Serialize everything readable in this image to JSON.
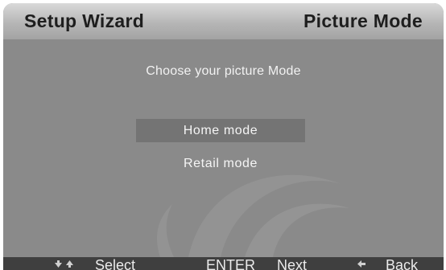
{
  "header": {
    "title": "Setup Wizard",
    "page": "Picture Mode"
  },
  "prompt": "Choose your picture Mode",
  "options": [
    {
      "label": "Home mode",
      "selected": true
    },
    {
      "label": "Retail mode",
      "selected": false
    }
  ],
  "footer": {
    "select_label": "Select",
    "select_icons": [
      "arrow-down-icon",
      "arrow-up-icon"
    ],
    "enter_key": "ENTER",
    "next_label": "Next",
    "back_icon": "arrow-left-icon",
    "back_label": "Back"
  },
  "colors": {
    "background": "#8a8a8a",
    "highlight": "#747474",
    "footer": "#3f3f3f",
    "text": "#f2f2f2"
  }
}
